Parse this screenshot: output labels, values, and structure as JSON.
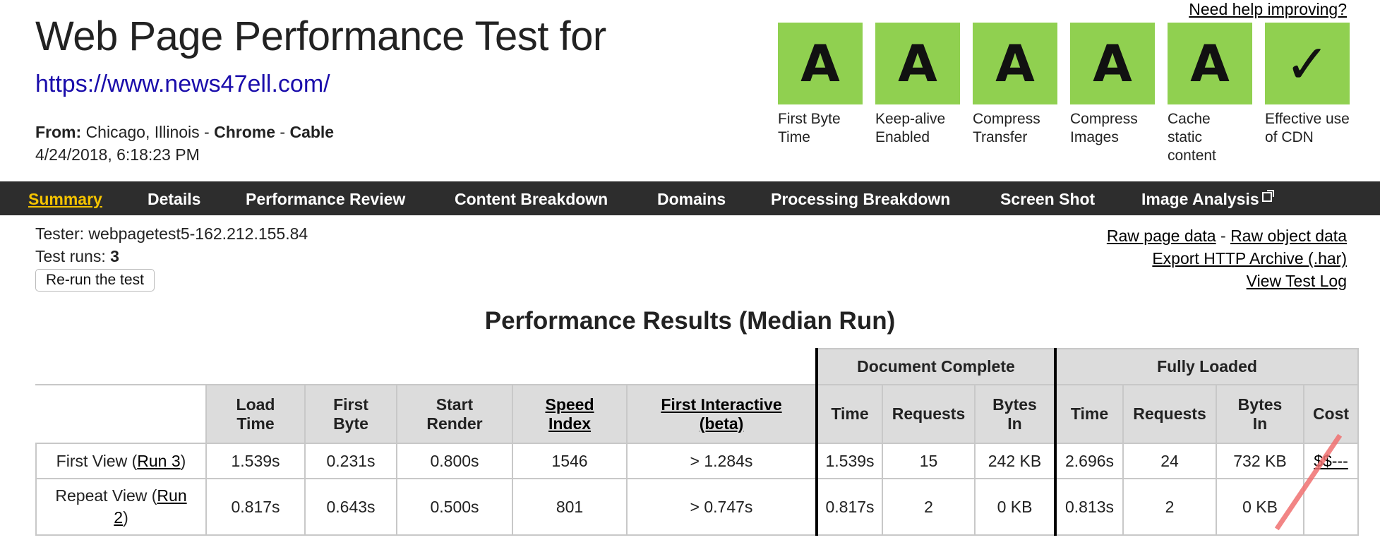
{
  "header": {
    "title": "Web Page Performance Test for",
    "url": "https://www.news47ell.com/",
    "from_label": "From:",
    "location": "Chicago, Illinois",
    "browser": "Chrome",
    "connection": "Cable",
    "date": "4/24/2018, 6:18:23 PM",
    "help_link": "Need help improving?"
  },
  "grades": [
    {
      "grade": "A",
      "label": "First Byte Time",
      "color": "#90d050"
    },
    {
      "grade": "A",
      "label": "Keep-alive Enabled",
      "color": "#90d050"
    },
    {
      "grade": "A",
      "label": "Compress Transfer",
      "color": "#90d050"
    },
    {
      "grade": "A",
      "label": "Compress Images",
      "color": "#90d050"
    },
    {
      "grade": "A",
      "label": "Cache static content",
      "color": "#90d050"
    },
    {
      "grade": "✓",
      "label": "Effective use of CDN",
      "color": "#90d050"
    }
  ],
  "nav": {
    "items": [
      "Summary",
      "Details",
      "Performance Review",
      "Content Breakdown",
      "Domains",
      "Processing Breakdown",
      "Screen Shot",
      "Image Analysis"
    ],
    "active": "Summary"
  },
  "test_info": {
    "tester_label": "Tester:",
    "tester": "webpagetest5-162.212.155.84",
    "runs_label": "Test runs:",
    "runs": "3",
    "rerun_button": "Re-run the test",
    "links": {
      "raw_page": "Raw page data",
      "separator": "-",
      "raw_object": "Raw object data",
      "har": "Export HTTP Archive (.har)",
      "log": "View Test Log"
    }
  },
  "results": {
    "title": "Performance Results (Median Run)",
    "group_headers": {
      "document_complete": "Document Complete",
      "fully_loaded": "Fully Loaded"
    },
    "columns": {
      "load_time": [
        "Load",
        "Time"
      ],
      "first_byte": [
        "First",
        "Byte"
      ],
      "start_render": [
        "Start",
        "Render"
      ],
      "speed_index": [
        "Speed",
        "Index"
      ],
      "first_interactive": [
        "First Interactive",
        "(beta)"
      ],
      "dc_time": "Time",
      "dc_requests": "Requests",
      "dc_bytes": [
        "Bytes",
        "In"
      ],
      "fl_time": "Time",
      "fl_requests": "Requests",
      "fl_bytes": [
        "Bytes",
        "In"
      ],
      "cost": "Cost"
    },
    "rows": [
      {
        "label_prefix": "First View (",
        "run_link": "Run 3",
        "label_suffix": ")",
        "load_time": "1.539s",
        "first_byte": "0.231s",
        "start_render": "0.800s",
        "speed_index": "1546",
        "first_interactive": "> 1.284s",
        "dc_time": "1.539s",
        "dc_requests": "15",
        "dc_bytes": "242 KB",
        "fl_time": "2.696s",
        "fl_requests": "24",
        "fl_bytes": "732 KB",
        "cost": "$$---"
      },
      {
        "label_prefix": "Repeat View (",
        "run_link_a": "Run",
        "run_link_b": "2",
        "label_suffix": ")",
        "load_time": "0.817s",
        "first_byte": "0.643s",
        "start_render": "0.500s",
        "speed_index": "801",
        "first_interactive": "> 0.747s",
        "dc_time": "0.817s",
        "dc_requests": "2",
        "dc_bytes": "0 KB",
        "fl_time": "0.813s",
        "fl_requests": "2",
        "fl_bytes": "0 KB",
        "cost": ""
      }
    ]
  }
}
